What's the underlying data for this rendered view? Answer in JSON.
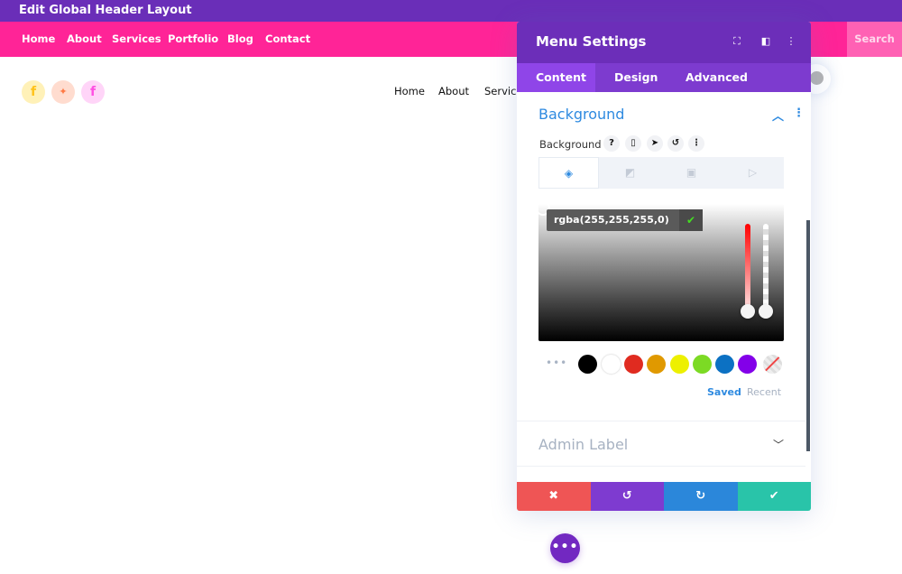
{
  "topbar": {
    "title": "Edit Global Header Layout"
  },
  "header_menu": {
    "items": [
      "Home",
      "About",
      "Services",
      "Portfolio",
      "Blog",
      "Contact"
    ],
    "search_label": "Search"
  },
  "social": {
    "icons": [
      {
        "name": "facebook",
        "glyph": "f",
        "bg": "#fff1b8",
        "color": "#ffc21a"
      },
      {
        "name": "twitter",
        "glyph": "🐦",
        "bg": "#ffdccf",
        "color": "#ff7a45"
      },
      {
        "name": "facebook",
        "glyph": "f",
        "bg": "#ffd5f8",
        "color": "#ff4fe2"
      }
    ]
  },
  "secondary_menu": {
    "items": [
      "Home",
      "About",
      "Service"
    ]
  },
  "panel": {
    "title": "Menu Settings",
    "header_icons": {
      "expand": "⛶",
      "split": "◧",
      "more": "⋮"
    },
    "tabs": [
      {
        "label": "Content",
        "active": true
      },
      {
        "label": "Design",
        "active": false
      },
      {
        "label": "Advanced",
        "active": false
      }
    ],
    "section": {
      "title": "Background",
      "field_label": "Background",
      "field_icons": [
        "?",
        "▯",
        "➤",
        "↺",
        "⋮"
      ],
      "bg_tabs": [
        "◈",
        "◩",
        "▣",
        "▷"
      ],
      "color_value": "rgba(255,255,255,0)",
      "hue": 0,
      "alpha": 0,
      "swatches": [
        "#000000",
        "#ffffff",
        "#e02b20",
        "#e09900",
        "#edf000",
        "#7cda24",
        "#0c71c3",
        "#8300e9"
      ],
      "saved_label": "Saved",
      "recent_label": "Recent"
    },
    "admin_label": "Admin Label",
    "footer": {
      "cancel": "✖",
      "undo": "↺",
      "redo": "↻",
      "save": "✔"
    }
  },
  "colors": {
    "topbar": "#6a2eb8",
    "nav": "#ff2497",
    "accent_blue": "#2e8ae0",
    "cancel": "#ef5555",
    "undo": "#7e3bd0",
    "redo": "#2b87da",
    "save": "#29c4a9"
  },
  "fab": {
    "label": "•••"
  }
}
